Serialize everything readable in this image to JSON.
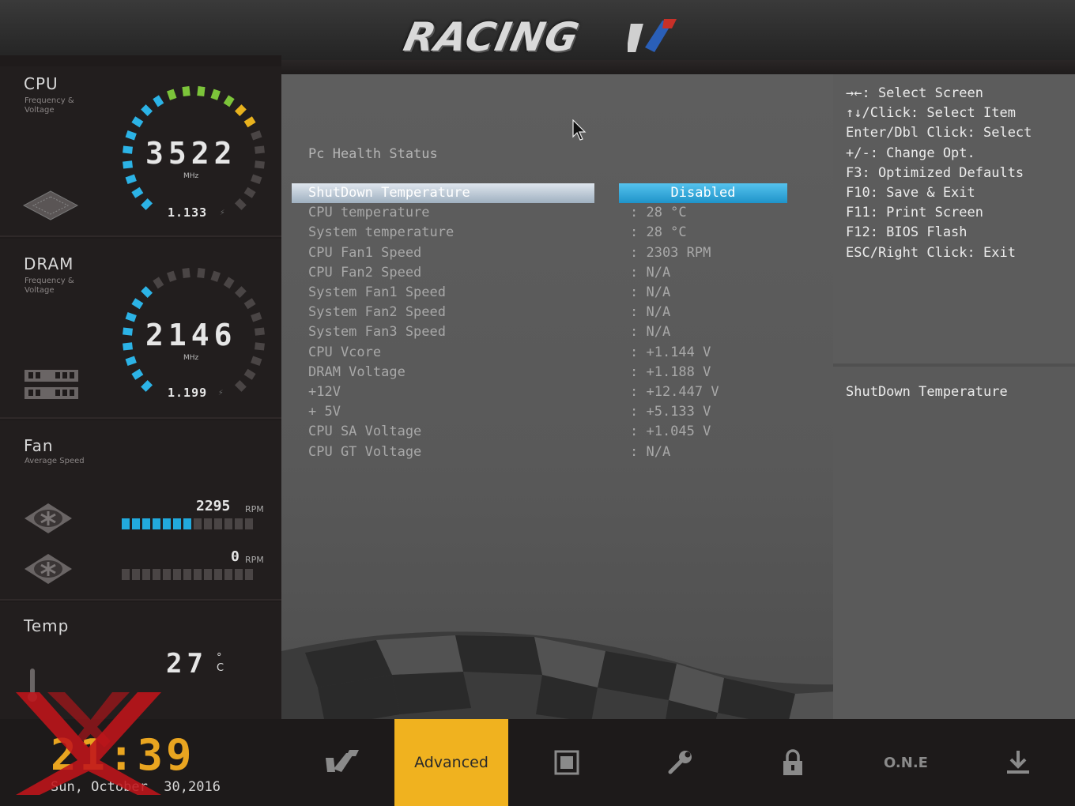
{
  "header": {
    "logo_text": "RACING"
  },
  "left_panel": {
    "cpu": {
      "title": "CPU",
      "subtitle": "Frequency & Voltage",
      "frequency": "3522",
      "unit": "MHz",
      "voltage": "1.133",
      "gauge_level": 0.72
    },
    "dram": {
      "title": "DRAM",
      "subtitle": "Frequency & Voltage",
      "frequency": "2146",
      "unit": "MHz",
      "voltage": "1.199",
      "gauge_level": 0.36
    },
    "fan": {
      "title": "Fan",
      "subtitle": "Average Speed",
      "fans": [
        {
          "rpm": "2295",
          "unit": "RPM",
          "bars_on": 7,
          "bars_total": 13
        },
        {
          "rpm": "0",
          "unit": "RPM",
          "bars_on": 0,
          "bars_total": 13
        }
      ]
    },
    "temp": {
      "title": "Temp",
      "value": "27",
      "unit": "°C"
    }
  },
  "main": {
    "page_title": "Pc Health Status",
    "rows": [
      {
        "label": "ShutDown Temperature",
        "value": "Disabled",
        "selected": true
      },
      {
        "label": "CPU temperature",
        "value": ": 28 °C"
      },
      {
        "label": "System temperature",
        "value": ": 28 °C"
      },
      {
        "label": "CPU Fan1 Speed",
        "value": ": 2303 RPM"
      },
      {
        "label": "CPU Fan2 Speed",
        "value": ": N/A"
      },
      {
        "label": "System Fan1 Speed",
        "value": ": N/A"
      },
      {
        "label": "System Fan2 Speed",
        "value": ": N/A"
      },
      {
        "label": "System Fan3 Speed",
        "value": ": N/A"
      },
      {
        "label": "CPU Vcore",
        "value": ": +1.144 V"
      },
      {
        "label": "DRAM Voltage",
        "value": ": +1.188 V"
      },
      {
        "label": "+12V",
        "value": ": +12.447 V"
      },
      {
        "label": "+ 5V",
        "value": ": +5.133 V"
      },
      {
        "label": "CPU SA Voltage",
        "value": ": +1.045 V"
      },
      {
        "label": "CPU GT Voltage",
        "value": ": N/A"
      }
    ]
  },
  "help": {
    "lines": [
      "→←: Select Screen",
      "↑↓/Click: Select Item",
      "Enter/Dbl Click: Select",
      "+/-: Change Opt.",
      "F3: Optimized Defaults",
      "F10: Save & Exit",
      "F11: Print Screen",
      "F12: BIOS Flash",
      "ESC/Right Click: Exit"
    ],
    "description": "ShutDown Temperature"
  },
  "bottom": {
    "clock": "21:39",
    "date": "Sun, October  30,2016",
    "tabs": [
      {
        "name": "main-tab",
        "icon": "racing-logo-icon"
      },
      {
        "name": "advanced-tab",
        "label": "Advanced",
        "active": true
      },
      {
        "name": "chipset-tab",
        "icon": "chip-icon"
      },
      {
        "name": "tools-tab",
        "icon": "wrench-icon"
      },
      {
        "name": "security-tab",
        "icon": "lock-icon"
      },
      {
        "name": "one-tab",
        "label": "O.N.E"
      },
      {
        "name": "save-exit-tab",
        "icon": "download-icon"
      }
    ]
  },
  "colors": {
    "accent": "#f0b21f",
    "selection_value": "#2aa4d8",
    "gauge_blue": "#2cb3e6",
    "gauge_green": "#7cc43a",
    "gauge_yellow": "#e8b21e"
  }
}
